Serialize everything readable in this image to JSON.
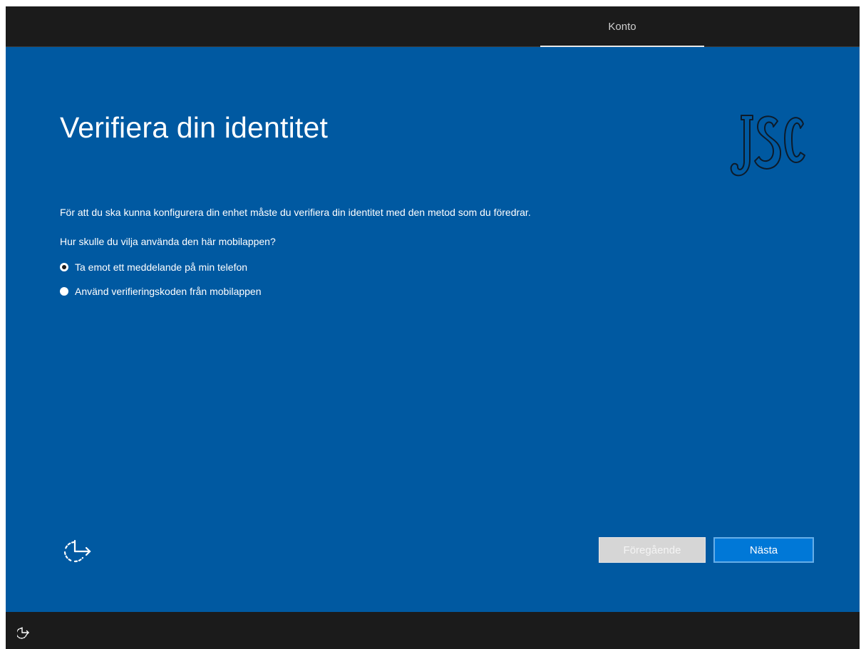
{
  "header": {
    "tab_label": "Konto"
  },
  "page": {
    "title": "Verifiera din identitet",
    "description": "För att du ska kunna konfigurera din enhet måste du verifiera din identitet med den metod som du föredrar.",
    "question": "Hur skulle du vilja använda den här mobilappen?",
    "options": [
      {
        "label": "Ta emot ett meddelande på min telefon",
        "selected": true
      },
      {
        "label": "Använd verifieringskoden från mobilappen",
        "selected": false
      }
    ],
    "logo_text": "JSC"
  },
  "footer": {
    "accessibility_icon": "ease-of-access-icon",
    "prev_label": "Föregående",
    "next_label": "Nästa",
    "bottom_icon": "ease-of-access-icon"
  },
  "colors": {
    "main_background": "#0059a1",
    "frame_background": "#1b1b1b",
    "primary_button": "#0078d7",
    "disabled_button": "#d6d6d6"
  }
}
